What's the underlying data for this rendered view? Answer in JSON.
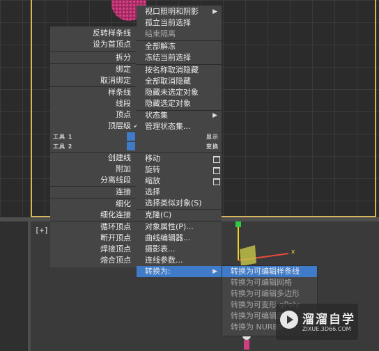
{
  "viewport": {
    "label": "[+]"
  },
  "left_menu": {
    "items": [
      "反转样条线",
      "设为首顶点",
      "拆分",
      "绑定",
      "取消绑定",
      "样条线",
      "线段",
      "顶点",
      "顶层级",
      "创建线",
      "附加",
      "分离线段",
      "连接",
      "细化",
      "细化连接",
      "循环顶点",
      "断开顶点",
      "焊接顶点",
      "熔合顶点"
    ],
    "check_mark": "✓",
    "tools1": "工具 1",
    "tools2": "工具 2"
  },
  "right_menu": {
    "items": [
      "视口照明和阴影",
      "孤立当前选择",
      "结束隔离",
      "全部解冻",
      "冻结当前选择",
      "按名称取消隐藏",
      "全部取消隐藏",
      "隐藏未选定对象",
      "隐藏选定对象",
      "状态集",
      "管理状态集...",
      "移动",
      "旋转",
      "缩放",
      "选择",
      "选择类似对象(S)",
      "克隆(C)",
      "对象属性(P)...",
      "曲线编辑器...",
      "摄影表...",
      "连线参数...",
      "转换为:"
    ],
    "display_label": "显示",
    "transform_label": "变换"
  },
  "submenu": {
    "items": [
      "转换为可编辑样条线",
      "转换为可编辑网格",
      "转换为可编辑多边形",
      "转换为可变形 gPoly",
      "转换为可编辑面片",
      "转换为 NURBS"
    ]
  },
  "watermark": {
    "title": "溜溜自学",
    "url": "ZIXUE.3D66.COM"
  },
  "colors": {
    "highlight": "#3f7bc9",
    "menu_bg": "#454545",
    "frame": "#d8b65a"
  }
}
